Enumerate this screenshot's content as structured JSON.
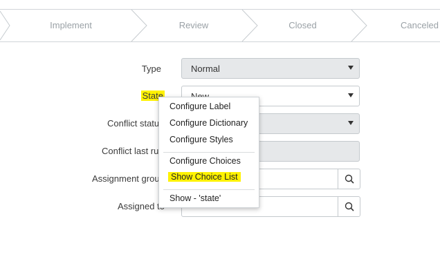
{
  "progress": {
    "stages": [
      "Implement",
      "Review",
      "Closed",
      "Canceled"
    ]
  },
  "form": {
    "type": {
      "label": "Type",
      "value": "Normal"
    },
    "state": {
      "label": "State",
      "value": "New"
    },
    "conflict_status": {
      "label": "Conflict statu"
    },
    "conflict_last_run": {
      "label": "Conflict last ru"
    },
    "assignment_group": {
      "label": "Assignment grou"
    },
    "assigned_to": {
      "label": "Assigned to"
    }
  },
  "context_menu": {
    "items": [
      "Configure Label",
      "Configure Dictionary",
      "Configure Styles",
      "Configure Choices",
      "Show Choice List",
      "Show - 'state'"
    ],
    "highlighted_item": "Show Choice List"
  },
  "colors": {
    "highlight": "#fff200",
    "stage_text": "#9aa1a6"
  },
  "icons": {
    "lookup": "search-icon",
    "dropdown": "chevron-down-icon"
  }
}
